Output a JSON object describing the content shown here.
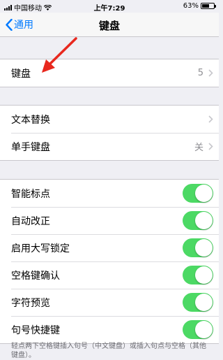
{
  "status_bar": {
    "carrier": "中国移动",
    "time": "上午7:29",
    "battery_percent": "63%",
    "battery_level": 0.63
  },
  "nav": {
    "back_label": "通用",
    "title": "键盘"
  },
  "section1": {
    "rows": [
      {
        "label": "键盘",
        "value": "5"
      }
    ]
  },
  "section2": {
    "rows": [
      {
        "label": "文本替换",
        "value": ""
      },
      {
        "label": "单手键盘",
        "value": "关"
      }
    ]
  },
  "section3": {
    "rows": [
      {
        "label": "智能标点",
        "on": true
      },
      {
        "label": "自动改正",
        "on": true
      },
      {
        "label": "启用大写锁定",
        "on": true
      },
      {
        "label": "空格键确认",
        "on": true
      },
      {
        "label": "字符预览",
        "on": true
      },
      {
        "label": "句号快捷键",
        "on": true
      }
    ]
  },
  "footer": "轻点两下空格键插入句号（中文键盘）或插入句点与空格（其他键盘）。",
  "colors": {
    "accent": "#007aff",
    "toggle_on": "#4cd964",
    "annotation_arrow": "#e8281e"
  }
}
